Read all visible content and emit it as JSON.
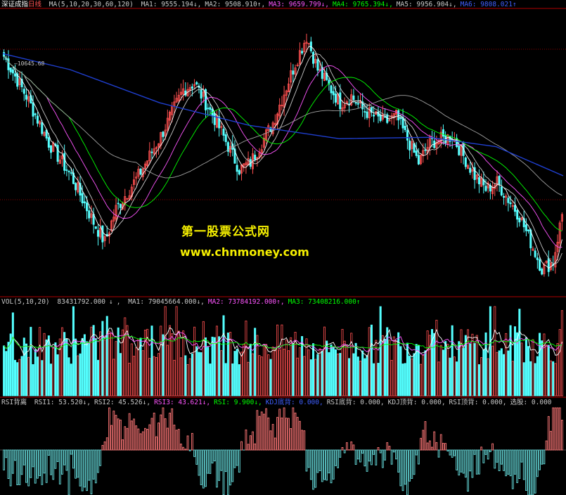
{
  "colors": {
    "background": "#000000",
    "up_candle": "#ff5050",
    "down_candle": "#54ffff",
    "ma1": "#ffffff",
    "ma2": "#ff55ff",
    "ma3": "#ffff00",
    "ma4": "#00ff00",
    "ma5": "#c8c8c8",
    "ma6": "#1f3fd0",
    "grid": "#8a0000",
    "rsi_pos": "#ff7777",
    "rsi_neg": "#66dddd",
    "watermark": "#f6f000"
  },
  "price_panel": {
    "security": "深证成指",
    "period": "日线",
    "ma_label": "MA(5,10,20,30,60,120)",
    "ma_values": [
      {
        "name": "MA1",
        "value": "9555.194",
        "dir": "↓",
        "color": "#c8c8c8"
      },
      {
        "name": "MA2",
        "value": "9508.910",
        "dir": "↑",
        "color": "#c8c8c8"
      },
      {
        "name": "MA3",
        "value": "9659.799",
        "dir": "↓",
        "color": "#ff55ff"
      },
      {
        "name": "MA4",
        "value": "9765.394",
        "dir": "↓",
        "color": "#00ff00"
      },
      {
        "name": "MA5",
        "value": "9956.904",
        "dir": "↓",
        "color": "#c8c8c8"
      },
      {
        "name": "MA6",
        "value": "9808.021",
        "dir": "↑",
        "color": "#3f5fff"
      }
    ],
    "high_label": "10645.68"
  },
  "volume_panel": {
    "label": "VOL(5,10,20)",
    "vol_value": "83431792.000",
    "vol_dir": "↓",
    "ma_values": [
      {
        "name": "MA1",
        "value": "79045664.000",
        "dir": "↓",
        "color": "#c8c8c8"
      },
      {
        "name": "MA2",
        "value": "73784192.000",
        "dir": "↑",
        "color": "#ff55ff"
      },
      {
        "name": "MA3",
        "value": "73408216.000",
        "dir": "↑",
        "color": "#00ff00"
      }
    ]
  },
  "rsi_panel": {
    "label": "RSI背离",
    "values": [
      {
        "name": "RSI1",
        "value": "53.520",
        "dir": "↓",
        "color": "#c8c8c8"
      },
      {
        "name": "RSI2",
        "value": "45.526",
        "dir": "↓",
        "color": "#c8c8c8"
      },
      {
        "name": "RSI3",
        "value": "43.621",
        "dir": "↓",
        "color": "#ff55ff"
      },
      {
        "name": "RSI",
        "value": "9.900",
        "dir": "↓",
        "color": "#00ff00"
      },
      {
        "name": "KDJ底背",
        "value": "0.000",
        "dir": "",
        "color": "#3f5fff"
      },
      {
        "name": "RSI底背",
        "value": "0.000",
        "dir": "",
        "color": "#c8c8c8"
      },
      {
        "name": "KDJ顶背",
        "value": "0.000",
        "dir": "",
        "color": "#c8c8c8"
      },
      {
        "name": "RSI顶背",
        "value": "0.000",
        "dir": "",
        "color": "#c8c8c8"
      },
      {
        "name": "选股",
        "value": "0.000",
        "dir": "",
        "color": "#c8c8c8"
      }
    ]
  },
  "watermark": {
    "title": "第一股票公式网",
    "url": "www.chnmoney.com"
  },
  "chart_data": {
    "type": "candlestick",
    "price_key_points": [
      [
        0,
        10400
      ],
      [
        10,
        10100
      ],
      [
        20,
        9750
      ],
      [
        30,
        9500
      ],
      [
        40,
        9150
      ],
      [
        45,
        9000
      ],
      [
        50,
        9250
      ],
      [
        60,
        9500
      ],
      [
        70,
        9800
      ],
      [
        80,
        10150
      ],
      [
        85,
        10200
      ],
      [
        95,
        9900
      ],
      [
        105,
        9550
      ],
      [
        110,
        9600
      ],
      [
        120,
        9900
      ],
      [
        130,
        10350
      ],
      [
        135,
        10550
      ],
      [
        140,
        10300
      ],
      [
        150,
        10050
      ],
      [
        155,
        10100
      ],
      [
        160,
        10000
      ],
      [
        170,
        9900
      ],
      [
        175,
        9950
      ],
      [
        185,
        9600
      ],
      [
        190,
        9750
      ],
      [
        200,
        9800
      ],
      [
        210,
        9500
      ],
      [
        215,
        9400
      ],
      [
        220,
        9450
      ],
      [
        230,
        9200
      ],
      [
        235,
        9000
      ],
      [
        240,
        8800
      ],
      [
        245,
        8850
      ],
      [
        250,
        9300
      ]
    ],
    "volume_ma_levels": {
      "MA1": 79045664,
      "MA2": 73784192,
      "MA3": 73408216
    }
  }
}
